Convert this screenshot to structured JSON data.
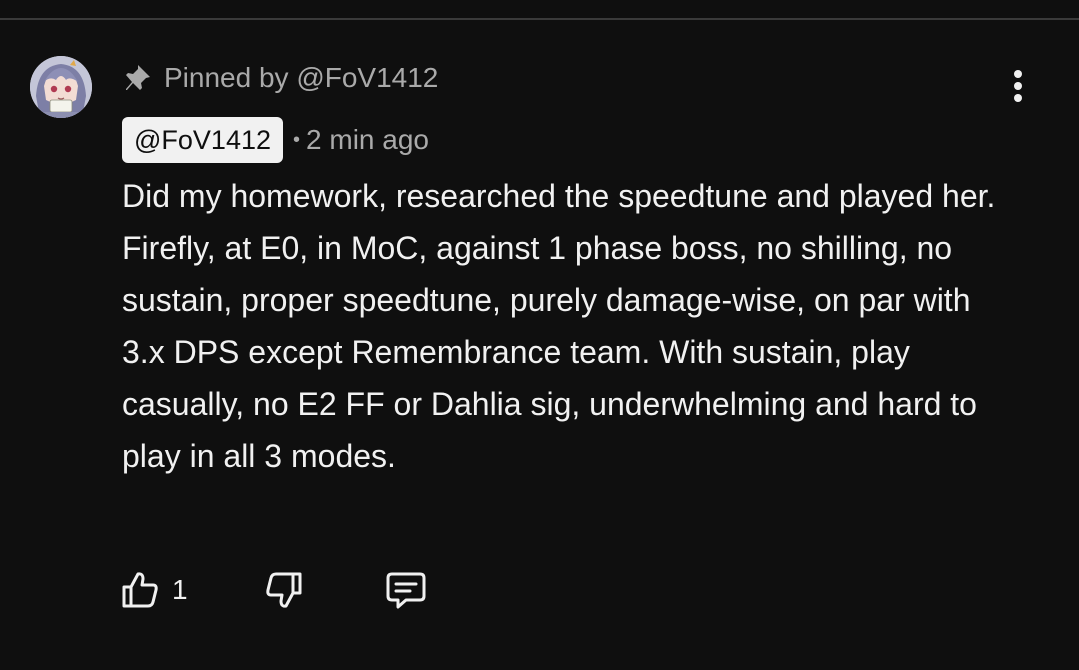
{
  "comment": {
    "pinned_label": "Pinned by @FoV1412",
    "author": "@FoV1412",
    "separator": "•",
    "timestamp": "2 min ago",
    "text": "Did my homework, researched the speedtune and played her. Firefly, at E0, in MoC, against 1 phase boss, no shilling, no sustain, proper speedtune, purely damage-wise, on par with 3.x DPS except Remembrance team. With sustain, play casually, no E2 FF or Dahlia sig, underwhelming and hard to play in all 3 modes.",
    "like_count": "1"
  },
  "icons": {
    "pin": "pin-icon",
    "more": "more-vert-icon",
    "like": "thumbs-up-icon",
    "dislike": "thumbs-down-icon",
    "reply": "reply-comment-icon"
  },
  "colors": {
    "background": "#0f0f0f",
    "text_primary": "#f1f1f1",
    "text_secondary": "#aaaaaa",
    "chip_background": "#f1f1f1"
  }
}
